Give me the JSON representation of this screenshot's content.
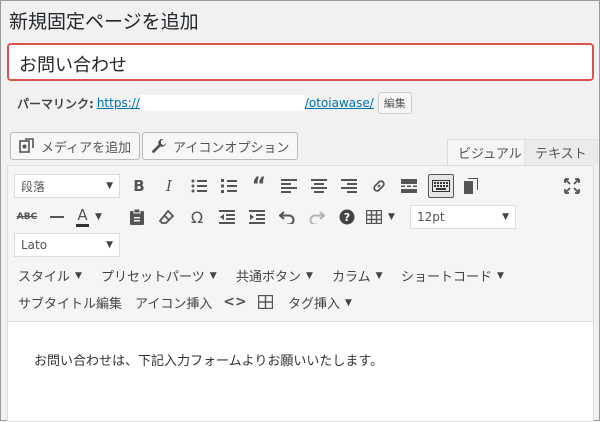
{
  "page": {
    "title": "新規固定ページを追加"
  },
  "post": {
    "title": "お問い合わせ"
  },
  "permalink": {
    "label": "パーマリンク:",
    "url_start": "https://",
    "url_end": "/otoiawase/",
    "edit_label": "編集"
  },
  "media_buttons": {
    "add_media": "メディアを追加",
    "icon_option": "アイコンオプション"
  },
  "tabs": {
    "visual": "ビジュアル",
    "text": "テキスト"
  },
  "toolbar": {
    "format_select": "段落",
    "font_size": "12pt",
    "font_family": "Lato",
    "menus_row3": [
      "スタイル",
      "プリセットパーツ",
      "共通ボタン",
      "カラム",
      "ショートコード"
    ],
    "menus_row4": [
      "サブタイトル編集",
      "アイコン挿入",
      "タグ挿入"
    ]
  },
  "content": {
    "text": "お問い合わせは、下記入力フォームよりお願いいたします。"
  },
  "colors": {
    "title_border": "#d9534f",
    "link": "#0073aa"
  }
}
